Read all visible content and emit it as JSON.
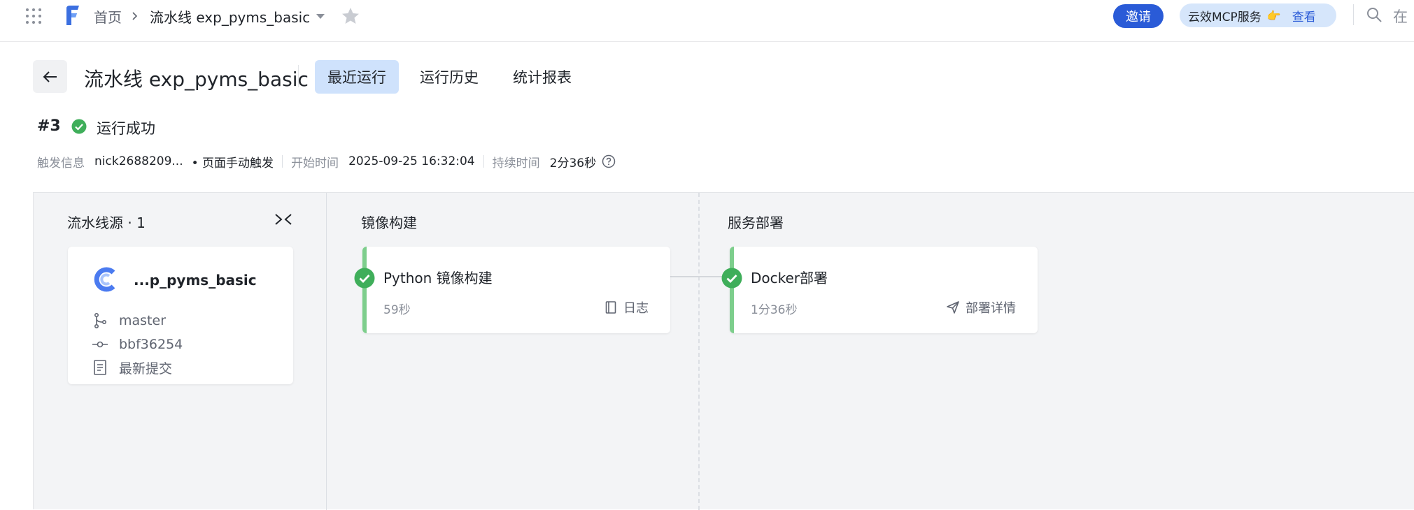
{
  "nav": {
    "breadcrumb_home": "首页",
    "breadcrumb_current": "流水线 exp_pyms_basic",
    "invite_label": "邀请",
    "promo_text": "云效MCP服务",
    "promo_emoji": "👉",
    "promo_link": "查看",
    "search_text": "在 ",
    "icons": [
      "apps-grid-icon",
      "logo-icon",
      "chevron-right-icon",
      "caret-down-icon",
      "star-icon",
      "search-icon"
    ]
  },
  "header": {
    "title": "流水线 exp_pyms_basic",
    "tabs": [
      {
        "label": "最近运行",
        "active": true
      },
      {
        "label": "运行历史",
        "active": false
      },
      {
        "label": "统计报表",
        "active": false
      }
    ]
  },
  "run": {
    "number": "#3",
    "status": "运行成功",
    "trigger_label": "触发信息",
    "trigger_user": "nick2688209...",
    "trigger_mode": "• 页面手动触发",
    "start_label": "开始时间",
    "start_time": "2025-09-25 16:32:04",
    "duration_label": "持续时间",
    "duration": "2分36秒"
  },
  "pipeline": {
    "source_title": "流水线源 · 1",
    "source": {
      "repo": "...p_pyms_basic",
      "branch": "master",
      "commit": "bbf36254",
      "commit_msg": "最新提交"
    },
    "stages": [
      {
        "title": "镜像构建",
        "job": {
          "name": "Python 镜像构建",
          "duration": "59秒",
          "action": "日志",
          "status": "success"
        }
      },
      {
        "title": "服务部署",
        "job": {
          "name": "Docker部署",
          "duration": "1分36秒",
          "action": "部署详情",
          "status": "success"
        }
      }
    ]
  },
  "colors": {
    "primary": "#2a5bd7",
    "success": "#3fae5a",
    "success_bar": "#7dce8c",
    "active_tab": "#cfe2fc",
    "canvas_bg": "#f3f4f6"
  }
}
